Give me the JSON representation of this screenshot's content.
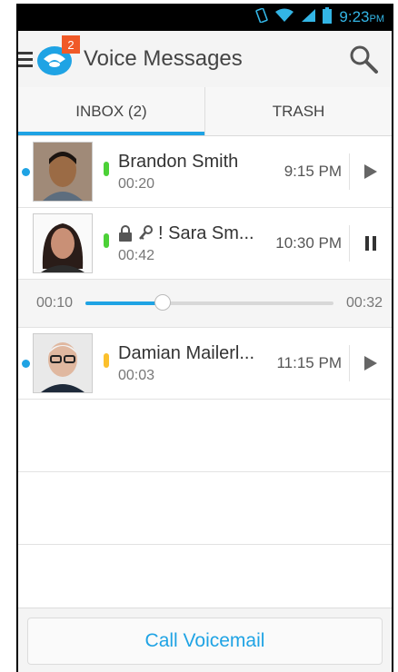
{
  "status_bar": {
    "time": "9:23",
    "ampm": "PM"
  },
  "app": {
    "title": "Voice Messages",
    "badge_count": "2"
  },
  "tabs": [
    {
      "label": "INBOX (2)",
      "active": true
    },
    {
      "label": "TRASH",
      "active": false
    }
  ],
  "messages": [
    {
      "name": "Brandon Smith",
      "duration": "00:20",
      "time": "9:15 PM",
      "status_color": "#4cd137",
      "unread": true,
      "control": "play"
    },
    {
      "name": "! Sara Sm...",
      "duration": "00:42",
      "time": "10:30 PM",
      "status_color": "#4cd137",
      "unread": false,
      "control": "pause"
    },
    {
      "name": "Damian Mailerl...",
      "duration": "00:03",
      "time": "11:15 PM",
      "status_color": "#fbc02d",
      "unread": true,
      "control": "play"
    }
  ],
  "player": {
    "elapsed": "00:10",
    "total": "00:32",
    "progress": 0.31
  },
  "footer": {
    "call_label": "Call Voicemail"
  },
  "colors": {
    "accent": "#1fa3e4",
    "badge": "#f05a28"
  }
}
